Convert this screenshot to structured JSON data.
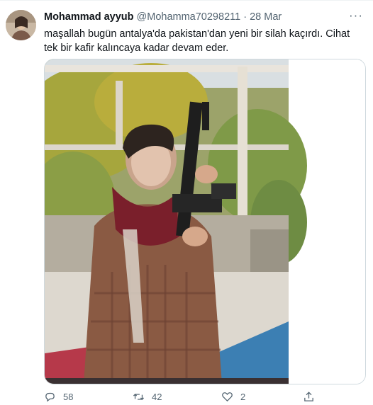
{
  "tweet": {
    "author_name": "Mohammad ayyub",
    "handle": "@Mohamma70298211",
    "separator": "·",
    "date": "28 Mar",
    "text": "maşallah bugün antalya'da pakistan'dan yeni bir silah kaçırdı. Cihat tek bir kafir kalıncaya kadar devam eder.",
    "more_label": "···"
  },
  "actions": {
    "replies": "58",
    "retweets": "42",
    "likes": "2"
  },
  "icons": {
    "reply": "reply-icon",
    "retweet": "retweet-icon",
    "like": "heart-icon",
    "share": "share-icon"
  },
  "colors": {
    "text": "#0f1419",
    "muted": "#536471",
    "border": "#cfd9de"
  }
}
